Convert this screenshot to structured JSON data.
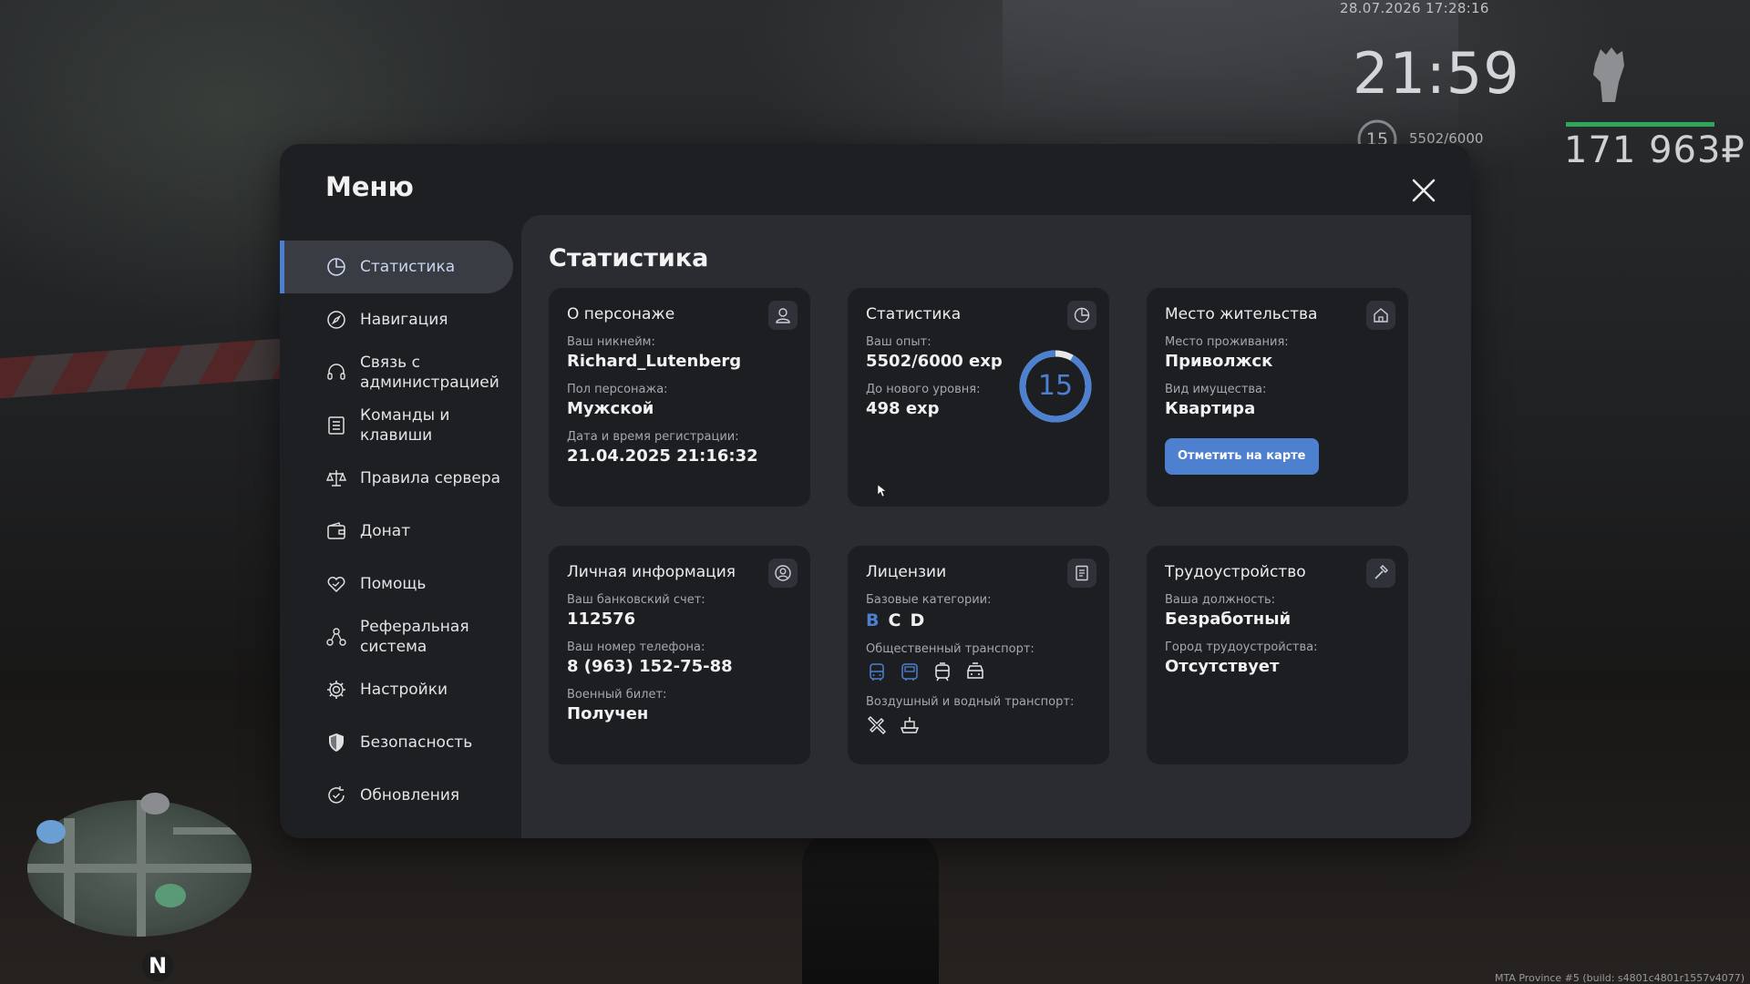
{
  "hud": {
    "date": "28.07.2026 17:28:16",
    "time": "21:59",
    "level": "15",
    "exp": "5502/6000",
    "money": "171 963₽",
    "build": "MTA Province #5 (build: s4801c4801r1557v4077)"
  },
  "modal": {
    "title": "Меню",
    "close_icon": "close-icon"
  },
  "sidebar": {
    "items": [
      {
        "label": "Статистика",
        "icon": "pie-chart-icon",
        "active": true
      },
      {
        "label": "Навигация",
        "icon": "compass-icon"
      },
      {
        "label": "Связь с администрацией",
        "icon": "headset-icon"
      },
      {
        "label": "Команды и клавиши",
        "icon": "list-icon"
      },
      {
        "label": "Правила сервера",
        "icon": "scales-icon"
      },
      {
        "label": "Донат",
        "icon": "wallet-icon"
      },
      {
        "label": "Помощь",
        "icon": "heart-hands-icon"
      },
      {
        "label": "Реферальная система",
        "icon": "referral-icon"
      },
      {
        "label": "Настройки",
        "icon": "gear-icon"
      },
      {
        "label": "Безопасность",
        "icon": "shield-icon"
      },
      {
        "label": "Обновления",
        "icon": "refresh-check-icon"
      }
    ]
  },
  "content": {
    "title": "Статистика",
    "character": {
      "title": "О персонаже",
      "icon": "user-icon",
      "nickname_label": "Ваш никнейм:",
      "nickname": "Richard_Lutenberg",
      "gender_label": "Пол персонажа:",
      "gender": "Мужской",
      "reg_label": "Дата и время регистрации:",
      "reg": "21.04.2025 21:16:32"
    },
    "stats": {
      "title": "Статистика",
      "icon": "clock-chart-icon",
      "exp_label": "Ваш опыт:",
      "exp": "5502/6000 exp",
      "next_label": "До нового уровня:",
      "next": "498 exp",
      "level": "15",
      "progress": 0.917,
      "accent": "#4d80cf"
    },
    "residence": {
      "title": "Место жительства",
      "icon": "home-icon",
      "place_label": "Место проживания:",
      "place": "Приволжск",
      "property_label": "Вид имущества:",
      "property": "Квартира",
      "button": "Отметить на карте"
    },
    "personal": {
      "title": "Личная информация",
      "icon": "user-circle-icon",
      "bank_label": "Ваш банковский счет:",
      "bank": "112576",
      "phone_label": "Ваш номер телефона:",
      "phone": "8 (963) 152-75-88",
      "military_label": "Военный билет:",
      "military": "Получен"
    },
    "licenses": {
      "title": "Лицензии",
      "icon": "document-icon",
      "base_label": "Базовые категории:",
      "categories": [
        "B",
        "C",
        "D"
      ],
      "public_label": "Общественный транспорт:",
      "public_icons": [
        "bus-icon",
        "bus-icon",
        "tram-icon",
        "taxi-icon"
      ],
      "air_label": "Воздушный и водный транспорт:",
      "air_icons": [
        "plane-icon",
        "boat-icon"
      ]
    },
    "employment": {
      "title": "Трудоустройство",
      "icon": "hammer-icon",
      "position_label": "Ваша должность:",
      "position": "Безработный",
      "city_label": "Город трудоустройства:",
      "city": "Отсутствует"
    }
  }
}
